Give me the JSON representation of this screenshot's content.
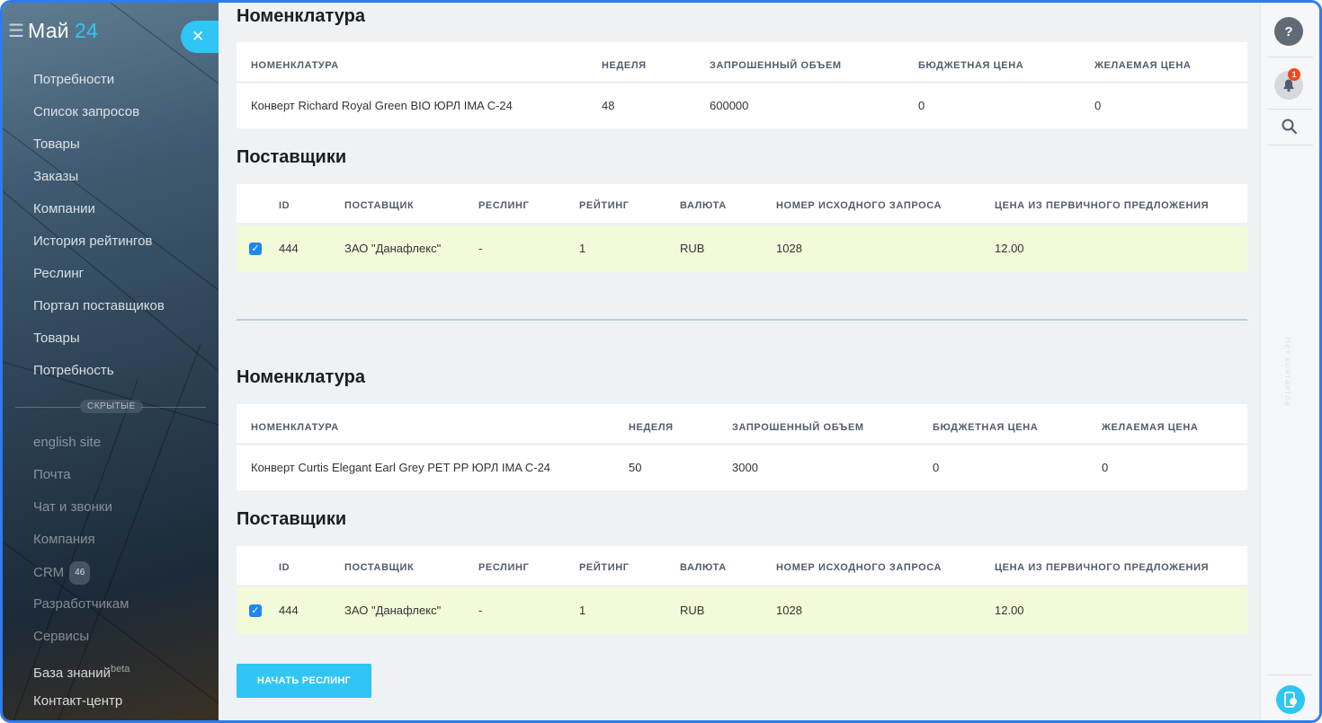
{
  "brand": {
    "name": "Май",
    "number": "24"
  },
  "sidebar": {
    "items": [
      {
        "label": "Потребности"
      },
      {
        "label": "Список запросов"
      },
      {
        "label": "Товары"
      },
      {
        "label": "Заказы"
      },
      {
        "label": "Компании"
      },
      {
        "label": "История рейтингов"
      },
      {
        "label": "Реслинг"
      },
      {
        "label": "Портал поставщиков"
      },
      {
        "label": "Товары"
      },
      {
        "label": "Потребность"
      }
    ],
    "hidden_label": "СКРЫТЫЕ",
    "hidden_items": [
      {
        "label": "english site"
      },
      {
        "label": "Почта"
      },
      {
        "label": "Чат и звонки"
      },
      {
        "label": "Компания"
      },
      {
        "label": "CRM",
        "count": "46"
      },
      {
        "label": "Разработчикам"
      },
      {
        "label": "Сервисы"
      },
      {
        "label": "База знаний",
        "sup": "beta"
      },
      {
        "label": "Контакт-центр"
      }
    ]
  },
  "blocks": [
    {
      "nomenclature_title": "Номенклатура",
      "nomenclature_headers": [
        "НОМЕНКЛАТУРА",
        "НЕДЕЛЯ",
        "ЗАПРОШЕННЫЙ ОБЪЕМ",
        "БЮДЖЕТНАЯ ЦЕНА",
        "ЖЕЛАЕМАЯ ЦЕНА"
      ],
      "nomenclature_row": [
        "Конверт Richard Royal Green BIO ЮРЛ IMA C-24",
        "48",
        "600000",
        "0",
        "0"
      ],
      "suppliers_title": "Поставщики",
      "supplier_headers": [
        "ID",
        "ПОСТАВЩИК",
        "РЕСЛИНГ",
        "РЕЙТИНГ",
        "ВАЛЮТА",
        "НОМЕР ИСХОДНОГО ЗАПРОСА",
        "ЦЕНА ИЗ ПЕРВИЧНОГО ПРЕДЛОЖЕНИЯ"
      ],
      "supplier_row": [
        "444",
        "ЗАО \"Данафлекс\"",
        "-",
        "1",
        "RUB",
        "1028",
        "12.00"
      ]
    },
    {
      "nomenclature_title": "Номенклатура",
      "nomenclature_headers": [
        "НОМЕНКЛАТУРА",
        "НЕДЕЛЯ",
        "ЗАПРОШЕННЫЙ ОБЪЕМ",
        "БЮДЖЕТНАЯ ЦЕНА",
        "ЖЕЛАЕМАЯ ЦЕНА"
      ],
      "nomenclature_row": [
        "Конверт Curtis Elegant Earl Grey PET PP ЮРЛ IMA C-24",
        "50",
        "3000",
        "0",
        "0"
      ],
      "suppliers_title": "Поставщики",
      "supplier_headers": [
        "ID",
        "ПОСТАВЩИК",
        "РЕСЛИНГ",
        "РЕЙТИНГ",
        "ВАЛЮТА",
        "НОМЕР ИСХОДНОГО ЗАПРОСА",
        "ЦЕНА ИЗ ПЕРВИЧНОГО ПРЕДЛОЖЕНИЯ"
      ],
      "supplier_row": [
        "444",
        "ЗАО \"Данафлекс\"",
        "-",
        "1",
        "RUB",
        "1028",
        "12.00"
      ]
    }
  ],
  "start_button": "НАЧАТЬ РЕСЛИНГ",
  "rail": {
    "help": "?",
    "notification_count": "1",
    "vertical_text": "Нет контактов"
  },
  "icons": [
    "menu-icon",
    "close-icon",
    "help-icon",
    "bell-icon",
    "search-icon",
    "phone-icon",
    "checkbox-checked-icon"
  ],
  "colors": {
    "accent": "#2fc6f6",
    "selected_row": "#f1fbd9",
    "badge": "#f54819",
    "checkbox": "#1e87f0"
  }
}
